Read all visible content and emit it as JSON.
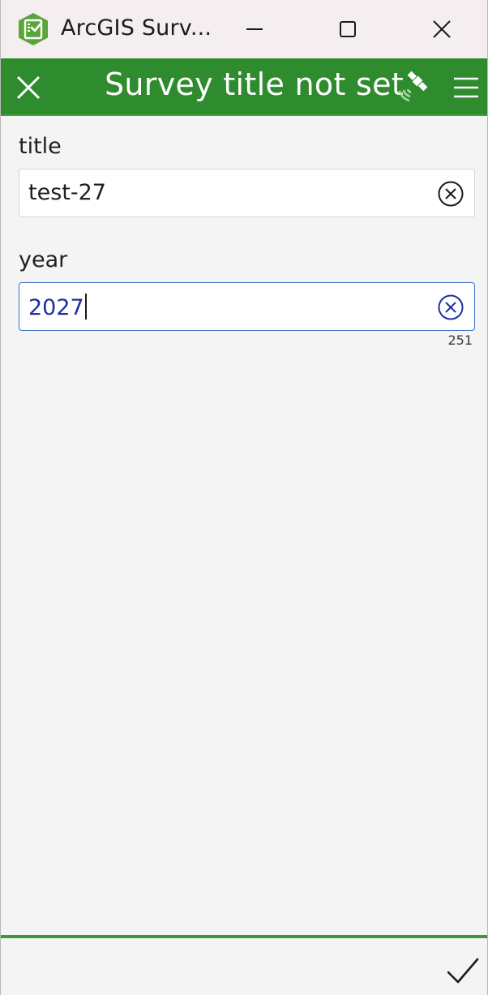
{
  "window": {
    "title": "ArcGIS Surv..."
  },
  "header": {
    "title": "Survey title not set"
  },
  "form": {
    "fields": [
      {
        "label": "title",
        "value": "test-27"
      },
      {
        "label": "year",
        "value": "2027",
        "remaining_chars": "251"
      }
    ]
  },
  "colors": {
    "header_green": "#2e8b2e",
    "accent_blue": "#1e2fa0",
    "focus_border": "#3b6fc4",
    "app_icon_green": "#5aa43a"
  },
  "icons": {
    "app": "clipboard-check-icon",
    "minimize": "minimize-icon",
    "maximize": "maximize-icon",
    "close": "close-icon",
    "header_close": "close-icon",
    "gps": "satellite-icon",
    "menu": "hamburger-menu-icon",
    "clear": "clear-circle-icon",
    "submit": "checkmark-icon"
  }
}
